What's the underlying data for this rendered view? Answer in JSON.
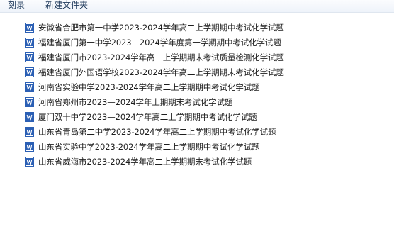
{
  "toolbar": {
    "burn_label": "刻录",
    "new_folder_label": "新建文件夹"
  },
  "files": [
    {
      "name": "安徽省合肥市第一中学2023-2024学年高二上学期期中考试化学试题",
      "icon": "word-doc-icon"
    },
    {
      "name": "福建省厦门第一中学2023—2024学年度第一学期期中考试化学试题",
      "icon": "word-doc-icon"
    },
    {
      "name": "福建省厦门市2023-2024学年高二上学期期末考试质量检测化学试题",
      "icon": "word-doc-icon"
    },
    {
      "name": "福建省厦门外国语学校2023-2024学年高二上学期期末考试化学试题",
      "icon": "word-doc-icon"
    },
    {
      "name": "河南省实验中学2023-2024学年高二上学期期中考试化学试题",
      "icon": "word-doc-icon"
    },
    {
      "name": "河南省郑州市2023—2024学年上期期末考试化学试题",
      "icon": "word-doc-icon"
    },
    {
      "name": "厦门双十中学2023—2024学年高二上学期期中考试化学试题",
      "icon": "word-doc-icon"
    },
    {
      "name": "山东省青岛第二中学2023-2024学年高二上学期期中考试化学试题",
      "icon": "word-doc-icon"
    },
    {
      "name": "山东省实验中学2023-2024学年高二上学期期中考试化学试题",
      "icon": "word-doc-icon"
    },
    {
      "name": "山东省威海市2023-2024学年高二上学期期末考试化学试题",
      "icon": "word-doc-icon"
    }
  ],
  "colors": {
    "icon_blue": "#2b5fb4",
    "toolbar_text": "#1e395b"
  }
}
